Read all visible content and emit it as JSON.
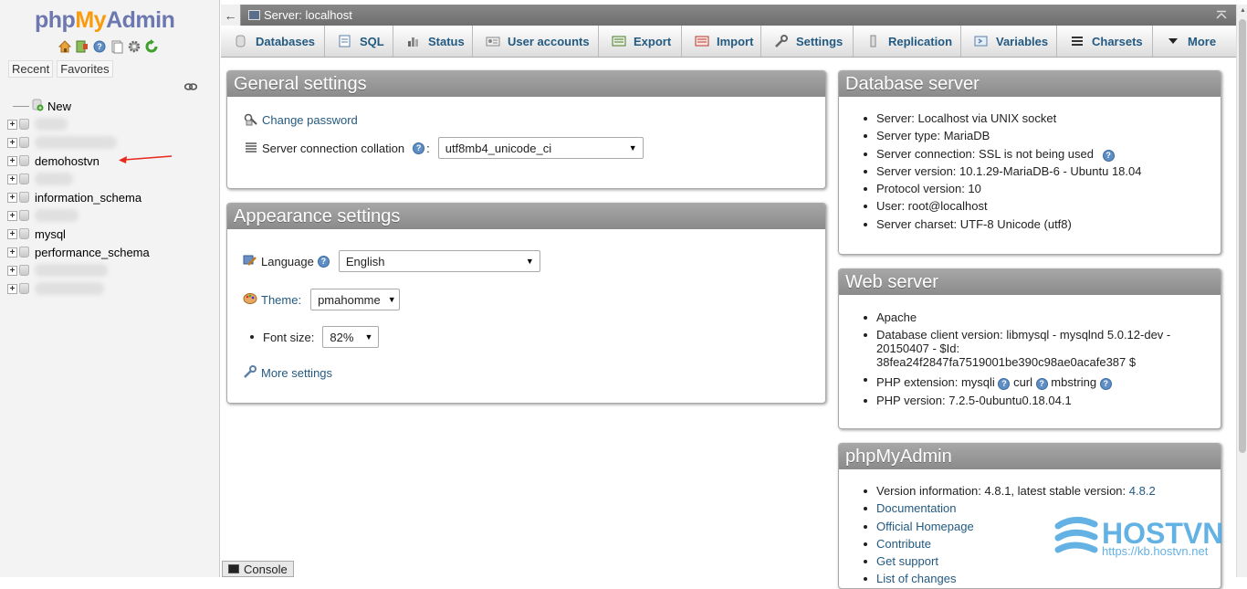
{
  "app": {
    "logo_php": "php",
    "logo_my": "My",
    "logo_admin": "Admin"
  },
  "nav": {
    "tabs": [
      "Recent",
      "Favorites"
    ],
    "tree": [
      {
        "label": "New",
        "type": "new"
      },
      {
        "label": "",
        "type": "blurred"
      },
      {
        "label": "",
        "type": "blurred"
      },
      {
        "label": "demohostvn",
        "type": "db"
      },
      {
        "label": "",
        "type": "blurred"
      },
      {
        "label": "information_schema",
        "type": "db"
      },
      {
        "label": "",
        "type": "blurred"
      },
      {
        "label": "mysql",
        "type": "db"
      },
      {
        "label": "performance_schema",
        "type": "db"
      },
      {
        "label": "",
        "type": "blurred"
      },
      {
        "label": "",
        "type": "blurred"
      }
    ]
  },
  "topbar": {
    "title": "Server: localhost"
  },
  "menubar": {
    "tabs": [
      "Databases",
      "SQL",
      "Status",
      "User accounts",
      "Export",
      "Import",
      "Settings",
      "Replication",
      "Variables",
      "Charsets",
      "More"
    ]
  },
  "general": {
    "title": "General settings",
    "change_password": "Change password",
    "collation_label": "Server connection collation",
    "collation_colon": ":",
    "collation_value": "utf8mb4_unicode_ci"
  },
  "appearance": {
    "title": "Appearance settings",
    "language_label": "Language",
    "language_value": "English",
    "theme_label": "Theme:",
    "theme_value": "pmahomme",
    "fontsize_label": "Font size:",
    "fontsize_value": "82%",
    "more_settings": "More settings"
  },
  "db_server": {
    "title": "Database server",
    "items": [
      "Server: Localhost via UNIX socket",
      "Server type: MariaDB",
      "Server connection: SSL is not being used",
      "Server version: 10.1.29-MariaDB-6 - Ubuntu 18.04",
      "Protocol version: 10",
      "User: root@localhost",
      "Server charset: UTF-8 Unicode (utf8)"
    ]
  },
  "web_server": {
    "title": "Web server",
    "apache": "Apache",
    "client_version": "Database client version: libmysql - mysqlnd 5.0.12-dev - 20150407 - $Id: 38fea24f2847fa7519001be390c98ae0acafe387 $",
    "php_ext_label": "PHP extension: mysqli",
    "php_ext_curl": "curl",
    "php_ext_mbstring": "mbstring",
    "php_version": "PHP version: 7.2.5-0ubuntu0.18.04.1"
  },
  "pma": {
    "title": "phpMyAdmin",
    "version_info": "Version information: 4.8.1, latest stable version:",
    "latest": "4.8.2",
    "links": [
      "Documentation",
      "Official Homepage",
      "Contribute",
      "Get support",
      "List of changes"
    ]
  },
  "console": {
    "label": "Console"
  },
  "watermark": {
    "brand": "HOSTVN",
    "url": "https://kb.hostvn.net"
  },
  "colors": {
    "link": "#235a81",
    "header": "#999999",
    "arrow": "#e8281c"
  }
}
